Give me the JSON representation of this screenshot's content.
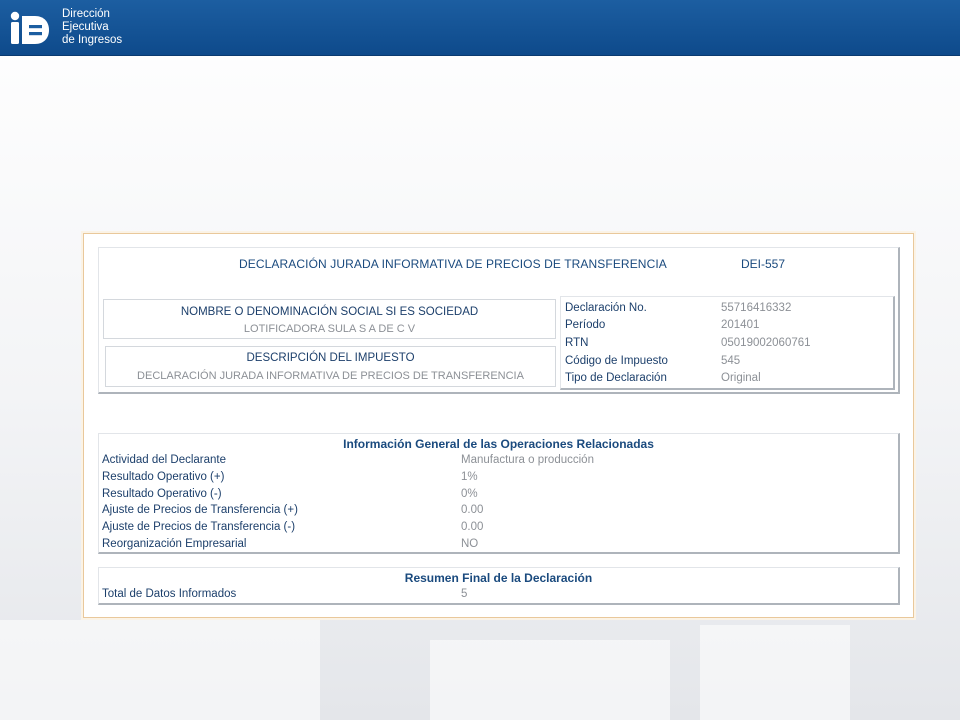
{
  "brand": {
    "name_lines": [
      "Dirección",
      "Ejecutiva",
      "de Ingresos"
    ]
  },
  "declaration": {
    "title": "DECLARACIÓN JURADA INFORMATIVA DE PRECIOS DE TRANSFERENCIA",
    "form_code": "DEI-557",
    "taxpayer": {
      "label": "NOMBRE O DENOMINACIÓN SOCIAL SI ES SOCIEDAD",
      "value": "LOTIFICADORA SULA S A DE C V"
    },
    "tax_description": {
      "label": "DESCRIPCIÓN DEL IMPUESTO",
      "value": "DECLARACIÓN JURADA INFORMATIVA DE PRECIOS DE TRANSFERENCIA"
    },
    "meta": [
      {
        "label": "Declaración No.",
        "value": "55716416332"
      },
      {
        "label": "Período",
        "value": "201401"
      },
      {
        "label": "RTN",
        "value": "05019002060761"
      },
      {
        "label": "Código de Impuesto",
        "value": "545"
      },
      {
        "label": "Tipo de Declaración",
        "value": "Original"
      }
    ]
  },
  "general_info": {
    "title": "Información General de las Operaciones Relacionadas",
    "rows": [
      {
        "label": "Actividad del Declarante",
        "value": "Manufactura o producción"
      },
      {
        "label": "Resultado Operativo (+)",
        "value": "1%"
      },
      {
        "label": "Resultado Operativo (-)",
        "value": "0%"
      },
      {
        "label": "Ajuste de Precios de Transferencia (+)",
        "value": "0.00"
      },
      {
        "label": "Ajuste de Precios de Transferencia (-)",
        "value": "0.00"
      },
      {
        "label": "Reorganización Empresarial",
        "value": "NO"
      }
    ]
  },
  "summary": {
    "title": "Resumen Final de la Declaración",
    "rows": [
      {
        "label": "Total de Datos Informados",
        "value": "5"
      }
    ]
  }
}
